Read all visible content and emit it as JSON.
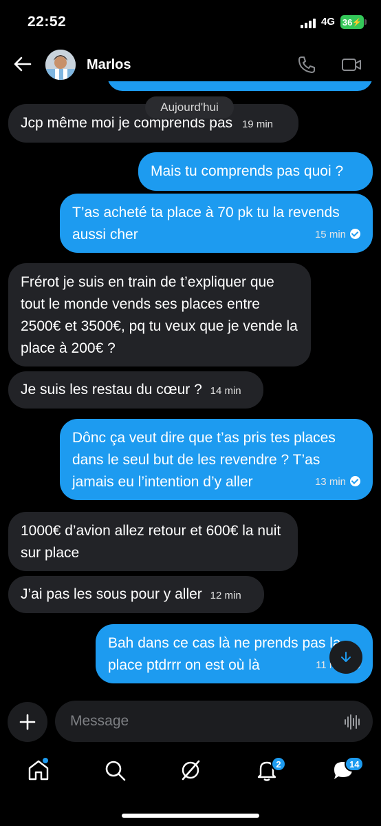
{
  "status_bar": {
    "time": "22:52",
    "network": "4G",
    "battery": "36"
  },
  "header": {
    "contact_name": "Marlos"
  },
  "chat": {
    "date_label": "Aujourd'hui",
    "messages": [
      {
        "dir": "in",
        "text": "Jcp même moi je comprends pas",
        "time": "19 min"
      },
      {
        "dir": "out",
        "text": "Mais tu comprends pas quoi ?",
        "time": ""
      },
      {
        "dir": "out",
        "text": "T’as acheté ta place à 70 pk tu la revends aussi cher",
        "time": "15 min"
      },
      {
        "dir": "in",
        "text": "Frérot je suis en train de t’expliquer que tout le monde vends ses places entre 2500€ et 3500€, pq tu veux que je vende la place à 200€ ?",
        "time": ""
      },
      {
        "dir": "in",
        "text": "Je suis les restau du cœur ?",
        "time": "14 min"
      },
      {
        "dir": "out",
        "text": "Dônc ça veut dire que t’as pris tes places dans le seul but de les revendre ? T’as jamais eu l’intention d’y aller",
        "time": "13 min"
      },
      {
        "dir": "in",
        "text": "1000€ d’avion allez retour et 600€ la nuit sur place",
        "time": ""
      },
      {
        "dir": "in",
        "text": "J’ai pas les sous pour y aller",
        "time": "12 min"
      },
      {
        "dir": "out",
        "text": "Bah dans ce cas là ne prends pas la place ptdrrr on est où là",
        "time": "11 min"
      }
    ]
  },
  "composer": {
    "placeholder": "Message"
  },
  "nav": {
    "notifications_badge": "2",
    "messages_badge": "14"
  },
  "colors": {
    "accent": "#1d9bf0",
    "incoming_bubble": "#222327",
    "background": "#000000"
  }
}
